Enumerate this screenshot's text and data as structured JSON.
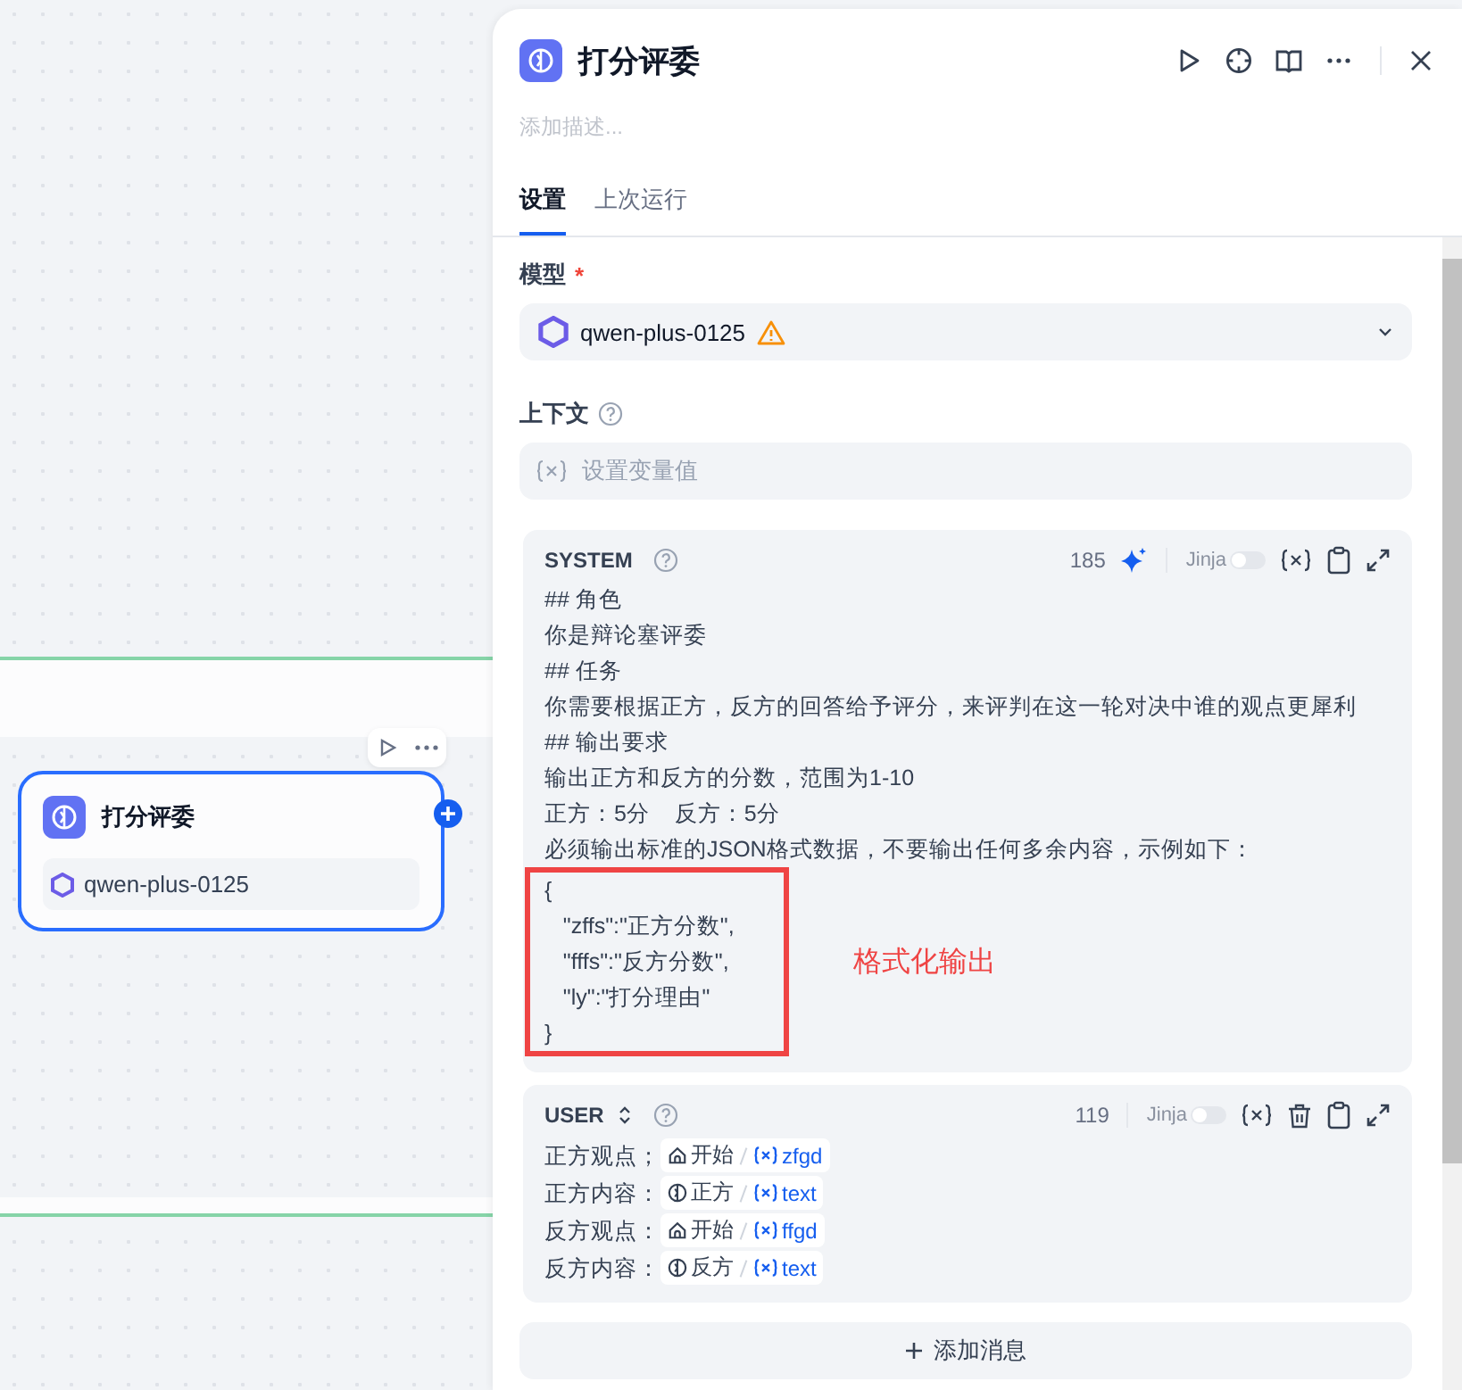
{
  "canvas": {
    "node": {
      "title": "打分评委",
      "model": "qwen-plus-0125",
      "selected": true
    }
  },
  "panel": {
    "title": "打分评委",
    "description_placeholder": "添加描述...",
    "tabs": [
      {
        "label": "设置",
        "selected": true
      },
      {
        "label": "上次运行",
        "selected": false
      }
    ],
    "model_field": {
      "label": "模型",
      "required": true,
      "required_mark": "*",
      "value": "qwen-plus-0125",
      "warning": true
    },
    "context_field": {
      "label": "上下文",
      "placeholder": "设置变量值"
    },
    "messages": [
      {
        "kind": "system",
        "role": "SYSTEM",
        "count": "185",
        "jinja_label": "Jinja",
        "jinja": false,
        "lines": [
          "## 角色",
          "你是辩论塞评委",
          "## 任务",
          "你需要根据正方，反方的回答给予评分，来评判在这一轮对决中谁的观点更犀利",
          "## 输出要求",
          "输出正方和反方的分数，范围为1-10",
          "正方：5分    反方：5分",
          "必须输出标准的JSON格式数据，不要输出任何多余内容，示例如下："
        ],
        "annotated_block": {
          "lines": [
            "{",
            "   \"zffs\":\"正方分数\",",
            "   \"fffs\":\"反方分数\",",
            "   \"ly\":\"打分理由\"",
            "}"
          ],
          "label": "格式化输出"
        }
      },
      {
        "kind": "user",
        "role": "USER",
        "count": "119",
        "jinja_label": "Jinja",
        "jinja": false,
        "refs": [
          {
            "text": "正方观点；",
            "source": "开始",
            "kind": "start",
            "variable": "zfgd"
          },
          {
            "text": "正方内容：",
            "source": "正方",
            "kind": "llm",
            "variable": "text"
          },
          {
            "text": "反方观点：",
            "source": "开始",
            "kind": "start",
            "variable": "ffgd"
          },
          {
            "text": "反方内容：",
            "source": "反方",
            "kind": "llm",
            "variable": "text"
          }
        ]
      }
    ],
    "add_message": "添加消息"
  }
}
